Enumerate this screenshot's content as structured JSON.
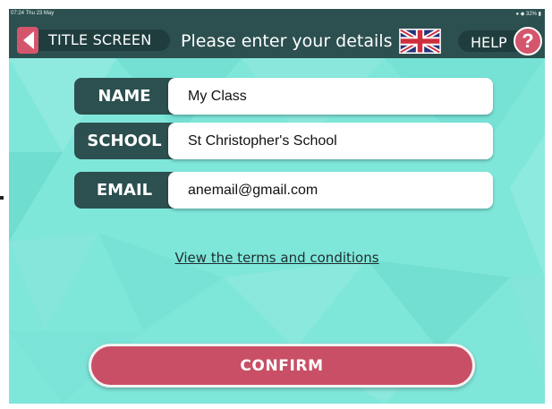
{
  "status_bar": {
    "time_date": "07:24  Thu 23 May",
    "indicators": "● ◆ 32% ▮"
  },
  "header": {
    "back_button_label": "TITLE SCREEN",
    "title": "Please enter your details",
    "language_icon": "uk-flag-icon",
    "help_label": "HELP",
    "help_symbol": "?"
  },
  "form": {
    "fields": [
      {
        "label": "NAME",
        "value": "My Class"
      },
      {
        "label": "SCHOOL",
        "value": "St Christopher's School"
      },
      {
        "label": "EMAIL",
        "value": "anemail@gmail.com"
      }
    ]
  },
  "terms_link": "View the terms and conditions",
  "confirm_label": "CONFIRM",
  "colors": {
    "background": "#7fe6da",
    "header": "#2c4f4f",
    "label_bg": "#2c4f4f",
    "accent": "#c84f66"
  }
}
